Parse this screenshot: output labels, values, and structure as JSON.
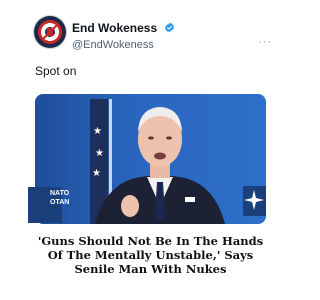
{
  "account": {
    "display_name": "End Wokeness",
    "handle": "@EndWokeness",
    "verified": true
  },
  "post": {
    "text": "Spot on",
    "more_label": "···"
  },
  "media": {
    "sign_left": "NATO\nOTAN",
    "headline": "'Guns Should Not Be In The Hands Of The Mentally Unstable,' Says Senile Man With Nukes"
  },
  "colors": {
    "verified_blue": "#1d9bf0",
    "background_blue": "#2a66c0"
  },
  "icons": {
    "verified": "verified-badge-icon",
    "more": "more-options-icon"
  }
}
